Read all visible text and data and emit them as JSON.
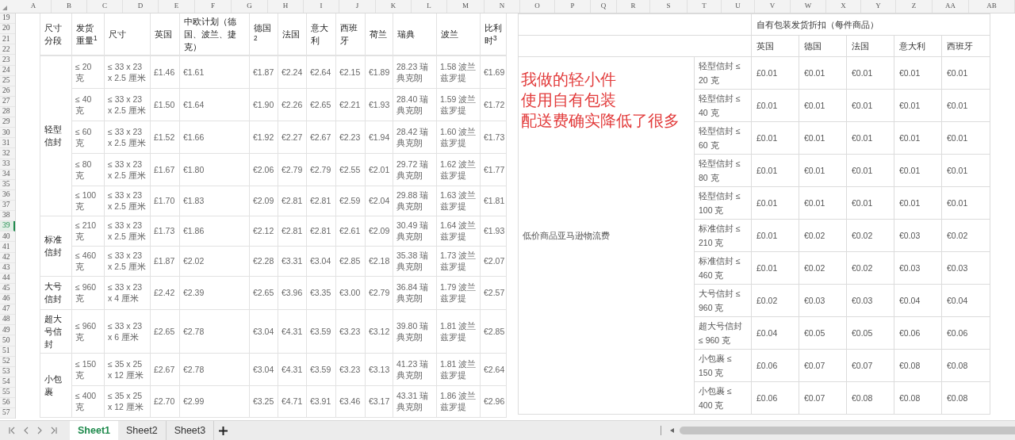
{
  "column_letters": [
    "A",
    "B",
    "C",
    "D",
    "E",
    "F",
    "G",
    "H",
    "I",
    "J",
    "K",
    "L",
    "M",
    "N",
    "O",
    "P",
    "Q",
    "R",
    "S",
    "T",
    "U",
    "V",
    "W",
    "X",
    "Y",
    "Z",
    "AA",
    "AB"
  ],
  "row_numbers": [
    {
      "label": "19",
      "selected": false
    },
    {
      "label": "20",
      "selected": false
    },
    {
      "label": "21",
      "selected": false
    },
    {
      "label": "22",
      "selected": false
    },
    {
      "label": "23",
      "selected": false
    },
    {
      "label": "24",
      "selected": false
    },
    {
      "label": "25",
      "selected": false
    },
    {
      "label": "26",
      "selected": false
    },
    {
      "label": "27",
      "selected": false
    },
    {
      "label": "28",
      "selected": false
    },
    {
      "label": "29",
      "selected": false
    },
    {
      "label": "30",
      "selected": false
    },
    {
      "label": "31",
      "selected": false
    },
    {
      "label": "32",
      "selected": false
    },
    {
      "label": "33",
      "selected": false
    },
    {
      "label": "34",
      "selected": false
    },
    {
      "label": "35",
      "selected": false
    },
    {
      "label": "36",
      "selected": false
    },
    {
      "label": "37",
      "selected": false
    },
    {
      "label": "38",
      "selected": false
    },
    {
      "label": "39",
      "selected": true
    },
    {
      "label": "40",
      "selected": false
    },
    {
      "label": "41",
      "selected": false
    },
    {
      "label": "42",
      "selected": false
    },
    {
      "label": "43",
      "selected": false
    },
    {
      "label": "44",
      "selected": false
    },
    {
      "label": "45",
      "selected": false
    },
    {
      "label": "46",
      "selected": false
    },
    {
      "label": "47",
      "selected": false
    },
    {
      "label": "48",
      "selected": false
    },
    {
      "label": "49",
      "selected": false
    },
    {
      "label": "50",
      "selected": false
    },
    {
      "label": "51",
      "selected": false
    },
    {
      "label": "52",
      "selected": false
    },
    {
      "label": "53",
      "selected": false
    },
    {
      "label": "54",
      "selected": false
    },
    {
      "label": "55",
      "selected": false
    },
    {
      "label": "56",
      "selected": false
    },
    {
      "label": "57",
      "selected": false
    }
  ],
  "fee_table": {
    "columns": [
      "尺寸分段",
      "发货重量$^{1}$",
      "尺寸",
      "英国",
      "中欧计划（德国、波兰、捷克）",
      "德国$^{2}$",
      "法国",
      "意大利",
      "西班牙",
      "荷兰",
      "瑞典",
      "波兰",
      "比利时$^{3}$"
    ],
    "groups": [
      {
        "label": "轻型信封",
        "rows": [
          [
            "≤ 20 克",
            "≤ 33 x 23 x 2.5 厘米",
            "£1.46",
            "€1.61",
            "€1.87",
            "€2.24",
            "€2.64",
            "€2.15",
            "€1.89",
            "28.23 瑞典克朗",
            "1.58 波兰兹罗提",
            "€1.69"
          ],
          [
            "≤ 40 克",
            "≤ 33 x 23 x 2.5 厘米",
            "£1.50",
            "€1.64",
            "€1.90",
            "€2.26",
            "€2.65",
            "€2.21",
            "€1.93",
            "28.40 瑞典克朗",
            "1.59 波兰兹罗提",
            "€1.72"
          ],
          [
            "≤ 60 克",
            "≤ 33 x 23 x 2.5 厘米",
            "£1.52",
            "€1.66",
            "€1.92",
            "€2.27",
            "€2.67",
            "€2.23",
            "€1.94",
            "28.42 瑞典克朗",
            "1.60 波兰兹罗提",
            "€1.73"
          ],
          [
            "≤ 80 克",
            "≤ 33 x 23 x 2.5 厘米",
            "£1.67",
            "€1.80",
            "€2.06",
            "€2.79",
            "€2.79",
            "€2.55",
            "€2.01",
            "29.72 瑞典克朗",
            "1.62 波兰兹罗提",
            "€1.77"
          ],
          [
            "≤ 100 克",
            "≤ 33 x 23 x 2.5 厘米",
            "£1.70",
            "€1.83",
            "€2.09",
            "€2.81",
            "€2.81",
            "€2.59",
            "€2.04",
            "29.88 瑞典克朗",
            "1.63 波兰兹罗提",
            "€1.81"
          ]
        ]
      },
      {
        "label": "标准信封",
        "rows": [
          [
            "≤ 210 克",
            "≤ 33 x 23 x 2.5 厘米",
            "£1.73",
            "€1.86",
            "€2.12",
            "€2.81",
            "€2.81",
            "€2.61",
            "€2.09",
            "30.49 瑞典克朗",
            "1.64 波兰兹罗提",
            "€1.93"
          ],
          [
            "≤ 460 克",
            "≤ 33 x 23 x 2.5 厘米",
            "£1.87",
            "€2.02",
            "€2.28",
            "€3.31",
            "€3.04",
            "€2.85",
            "€2.18",
            "35.38 瑞典克朗",
            "1.73 波兰兹罗提",
            "€2.07"
          ]
        ]
      },
      {
        "label": "大号信封",
        "rows": [
          [
            "≤ 960 克",
            "≤ 33 x 23 x 4 厘米",
            "£2.42",
            "€2.39",
            "€2.65",
            "€3.96",
            "€3.35",
            "€3.00",
            "€2.79",
            "36.84 瑞典克朗",
            "1.79 波兰兹罗提",
            "€2.57"
          ]
        ]
      },
      {
        "label": "超大号信封",
        "rows": [
          [
            "≤ 960 克",
            "≤ 33 x 23 x 6 厘米",
            "£2.65",
            "€2.78",
            "€3.04",
            "€4.31",
            "€3.59",
            "€3.23",
            "€3.12",
            "39.80 瑞典克朗",
            "1.81 波兰兹罗提",
            "€2.85"
          ]
        ]
      },
      {
        "label": "小包裹",
        "rows": [
          [
            "≤ 150 克",
            "≤ 35 x 25 x 12 厘米",
            "£2.67",
            "€2.78",
            "€3.04",
            "€4.31",
            "€3.59",
            "€3.23",
            "€3.13",
            "41.23 瑞典克朗",
            "1.81 波兰兹罗提",
            "€2.64"
          ],
          [
            "≤ 400 克",
            "≤ 35 x 25 x 12 厘米",
            "£2.70",
            "€2.99",
            "€3.25",
            "€4.71",
            "€3.91",
            "€3.46",
            "€3.17",
            "43.31 瑞典克朗",
            "1.86 波兰兹罗提",
            "€2.96"
          ]
        ]
      }
    ]
  },
  "discount_table": {
    "title": "自有包装发货折扣（每件商品）",
    "columns": [
      "英国",
      "德国",
      "法国",
      "意大利",
      "西班牙"
    ],
    "row_label": "低价商品亚马逊物流费",
    "annotation": [
      "我做的轻小件",
      "使用自有包装",
      "配送费确实降低了很多"
    ],
    "rows": [
      {
        "tier": "轻型信封 ≤ 20 克",
        "values": [
          "£0.01",
          "€0.01",
          "€0.01",
          "€0.01",
          "€0.01"
        ]
      },
      {
        "tier": "轻型信封 ≤ 40 克",
        "values": [
          "£0.01",
          "€0.01",
          "€0.01",
          "€0.01",
          "€0.01"
        ]
      },
      {
        "tier": "轻型信封 ≤ 60 克",
        "values": [
          "£0.01",
          "€0.01",
          "€0.01",
          "€0.01",
          "€0.01"
        ]
      },
      {
        "tier": "轻型信封 ≤ 80 克",
        "values": [
          "£0.01",
          "€0.01",
          "€0.01",
          "€0.01",
          "€0.01"
        ]
      },
      {
        "tier": "轻型信封 ≤ 100 克",
        "values": [
          "£0.01",
          "€0.01",
          "€0.01",
          "€0.01",
          "€0.01"
        ]
      },
      {
        "tier": "标准信封 ≤ 210 克",
        "values": [
          "£0.01",
          "€0.02",
          "€0.02",
          "€0.03",
          "€0.02"
        ]
      },
      {
        "tier": "标准信封 ≤ 460 克",
        "values": [
          "£0.01",
          "€0.02",
          "€0.02",
          "€0.03",
          "€0.03"
        ]
      },
      {
        "tier": "大号信封 ≤ 960 克",
        "values": [
          "£0.02",
          "€0.03",
          "€0.03",
          "€0.04",
          "€0.04"
        ]
      },
      {
        "tier": "超大号信封 ≤ 960 克",
        "values": [
          "£0.04",
          "€0.05",
          "€0.05",
          "€0.06",
          "€0.06"
        ]
      },
      {
        "tier": "小包裹 ≤ 150 克",
        "values": [
          "£0.06",
          "€0.07",
          "€0.07",
          "€0.08",
          "€0.08"
        ]
      },
      {
        "tier": "小包裹 ≤ 400 克",
        "values": [
          "£0.06",
          "€0.07",
          "€0.08",
          "€0.08",
          "€0.08"
        ]
      }
    ]
  },
  "sheet_tabs": [
    {
      "label": "Sheet1",
      "selected": true
    },
    {
      "label": "Sheet2",
      "selected": false
    },
    {
      "label": "Sheet3",
      "selected": false
    }
  ]
}
